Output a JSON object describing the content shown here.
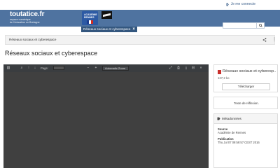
{
  "header": {
    "login_label": "Je me connecte",
    "brand_title": "toutatice.fr",
    "brand_sub_1": "espace numérique",
    "brand_sub_2": "de l'éducation en Bretagne",
    "edu_logo_text": "ACADÉMIE RENNES",
    "search_placeholder": ""
  },
  "tabs": [
    {
      "label": "Réseaux sociaux et cyberespace"
    }
  ],
  "breadcrumb": {
    "label": "Réseaux sociaux et cyberespace"
  },
  "page": {
    "title": "Réseaux sociaux et cyberespace"
  },
  "viewer": {
    "page_label": "Page:",
    "page_value": "",
    "zoom_value": "Automatic Zoom"
  },
  "file": {
    "name": "Réseaux sociaux et cyberesp...",
    "size": "127,2 ko",
    "download_label": "Télécharger"
  },
  "reflection": {
    "label": "Texte de réflexion."
  },
  "metadata": {
    "title": "Métadonnées",
    "source_label": "Source",
    "source_value": "Académie de Rennes",
    "publication_label": "Publication",
    "publication_value": "Thu Jul 07 09:59:57 CEST 2016"
  },
  "colors": {
    "banner": "#4f73a0",
    "tab": "#34577f",
    "viewer_bg": "#404040",
    "pdf_red": "#c9302c"
  }
}
